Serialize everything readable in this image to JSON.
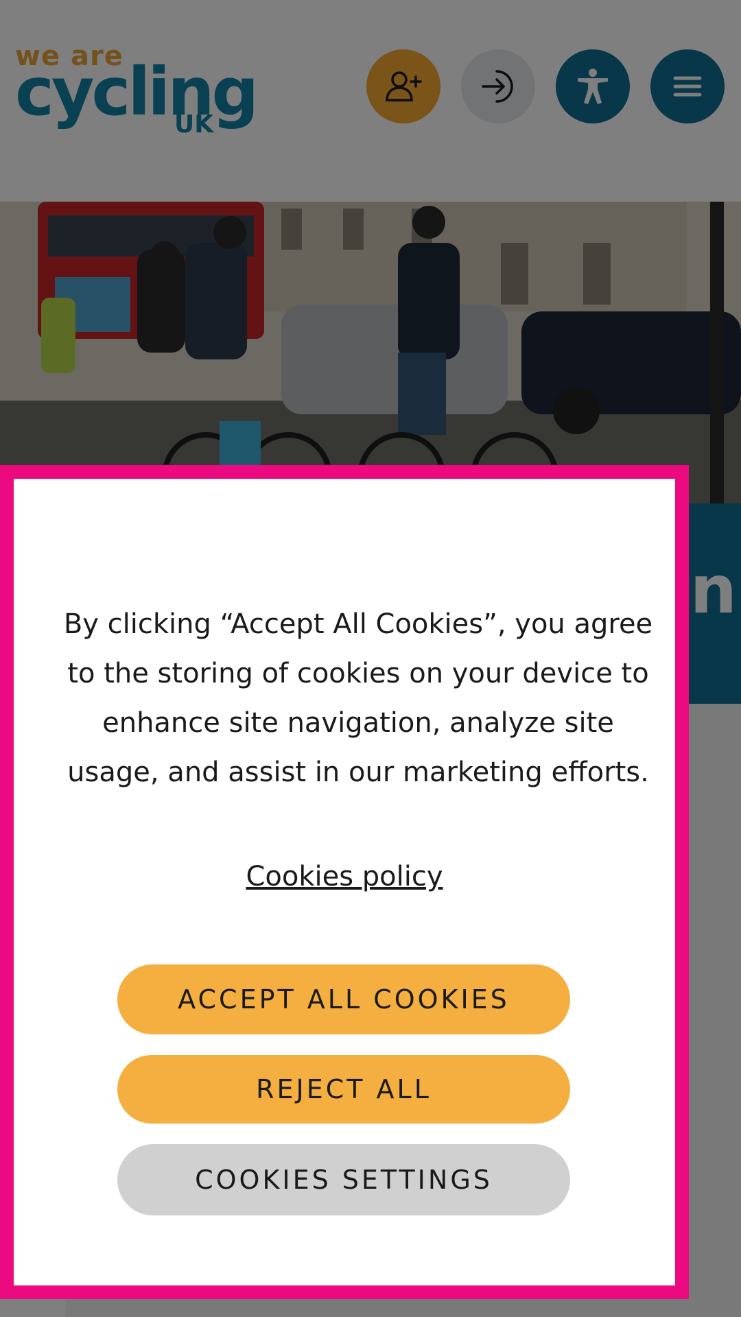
{
  "header": {
    "logo_line1": "we are",
    "logo_line2": "cycling",
    "logo_line3": "UK",
    "buttons": [
      {
        "icon": "user-plus-icon"
      },
      {
        "icon": "sign-in-icon"
      },
      {
        "icon": "accessibility-icon"
      },
      {
        "icon": "hamburger-menu-icon"
      }
    ]
  },
  "hero": {
    "image": "street scene of cyclists at a junction with a red double-decker bus and cars"
  },
  "teal_band_text": "n",
  "cookie_dialog": {
    "message": "By clicking “Accept All Cookies”, you agree to the storing of cookies on your device to enhance site navigation, analyze site usage, and assist in our marketing efforts.",
    "policy_link": "Cookies policy",
    "accept_label": "ACCEPT ALL COOKIES",
    "reject_label": "REJECT ALL",
    "settings_label": "COOKIES SETTINGS"
  },
  "colors": {
    "brand_teal": "#0e6f93",
    "brand_orange": "#f4a830",
    "dialog_border": "#ec0a80",
    "button_orange": "#f4af40",
    "button_grey": "#d0d0d0"
  }
}
